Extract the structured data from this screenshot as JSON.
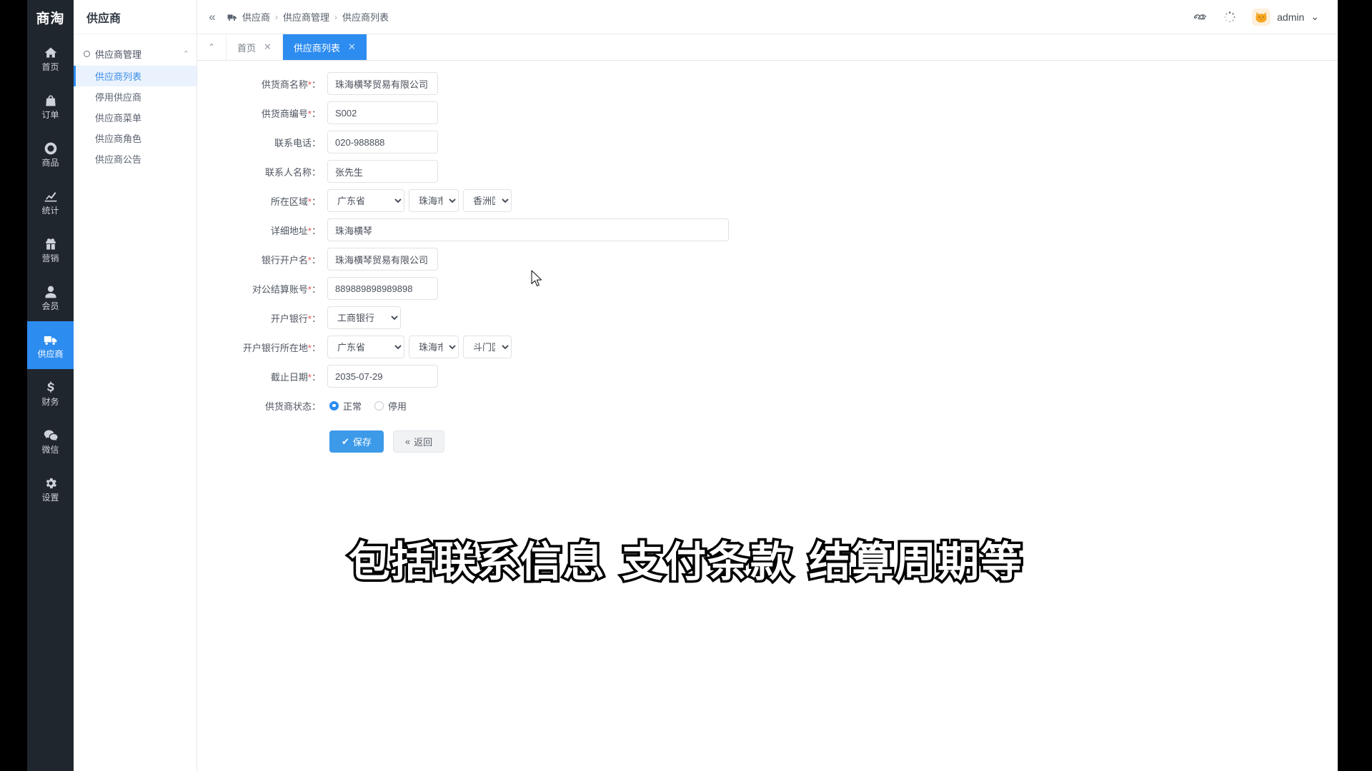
{
  "brand": {
    "name": "商淘"
  },
  "rail": {
    "items": [
      {
        "label": "首页",
        "icon": "home-icon",
        "active": false
      },
      {
        "label": "订单",
        "icon": "bag-icon",
        "active": false
      },
      {
        "label": "商品",
        "icon": "circle-icon",
        "active": false
      },
      {
        "label": "统计",
        "icon": "chart-icon",
        "active": false
      },
      {
        "label": "营销",
        "icon": "gift-icon",
        "active": false
      },
      {
        "label": "会员",
        "icon": "user-icon",
        "active": false
      },
      {
        "label": "供应商",
        "icon": "truck-icon",
        "active": true
      },
      {
        "label": "财务",
        "icon": "dollar-icon",
        "active": false
      },
      {
        "label": "微信",
        "icon": "wechat-icon",
        "active": false
      },
      {
        "label": "设置",
        "icon": "gear-icon",
        "active": false
      }
    ]
  },
  "submenu": {
    "title": "供应商",
    "group_label": "供应商管理",
    "items": [
      {
        "label": "供应商列表",
        "active": true
      },
      {
        "label": "停用供应商",
        "active": false
      },
      {
        "label": "供应商菜单",
        "active": false
      },
      {
        "label": "供应商角色",
        "active": false
      },
      {
        "label": "供应商公告",
        "active": false
      }
    ]
  },
  "header": {
    "collapse_icon": "«",
    "breadcrumb": [
      "供应商",
      "供应商管理",
      "供应商列表"
    ],
    "breadcrumb_sep": "›",
    "user_name": "admin",
    "user_caret": "⌄"
  },
  "tabs": {
    "collapse_icon": "⌃",
    "items": [
      {
        "label": "首页",
        "active": false,
        "close": "✕"
      },
      {
        "label": "供应商列表",
        "active": true,
        "close": "✕"
      }
    ]
  },
  "form": {
    "fields": [
      {
        "label": "供货商名称",
        "required": true,
        "value": "珠海横琴贸易有限公司"
      },
      {
        "label": "供货商编号",
        "required": true,
        "value": "S002"
      },
      {
        "label": "联系电话",
        "required": false,
        "value": "020-988888"
      },
      {
        "label": "联系人名称",
        "required": false,
        "value": "张先生"
      }
    ],
    "region": {
      "label": "所在区域",
      "required": true,
      "province": "广东省",
      "city": "珠海市",
      "district": "香洲区"
    },
    "address": {
      "label": "详细地址",
      "required": true,
      "value": "珠海横琴"
    },
    "bank_account_name": {
      "label": "银行开户名",
      "required": true,
      "value": "珠海横琴贸易有限公司"
    },
    "settlement_account": {
      "label": "对公结算账号",
      "required": true,
      "value": "889889898989898"
    },
    "bank": {
      "label": "开户银行",
      "required": true,
      "value": "工商银行"
    },
    "bank_region": {
      "label": "开户银行所在地",
      "required": true,
      "province": "广东省",
      "city": "珠海市",
      "district": "斗门区"
    },
    "deadline": {
      "label": "截止日期",
      "required": true,
      "value": "2035-07-29"
    },
    "status": {
      "label": "供货商状态",
      "options": [
        {
          "label": "正常",
          "selected": true
        },
        {
          "label": "停用",
          "selected": false
        }
      ]
    },
    "buttons": {
      "save": "保存",
      "save_icon": "✔",
      "back": "返回",
      "back_icon": "«"
    },
    "required_mark": "*",
    "label_colon": "："
  },
  "caption": {
    "text": "包括联系信息 支付条款 结算周期等"
  },
  "colors": {
    "rail_bg": "#20262e",
    "accent": "#2d8cf0",
    "active_menu_bg": "#eaf2fd",
    "required": "#ee4f4f",
    "avatar_bg": "#fdf0dc"
  }
}
